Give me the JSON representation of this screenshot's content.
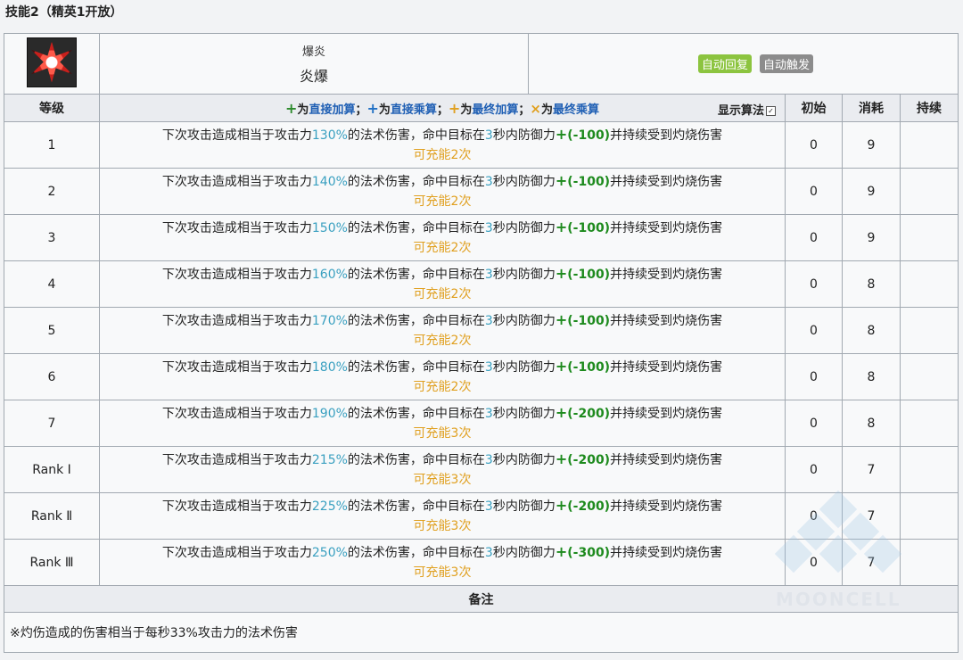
{
  "section_title": "技能2（精英1开放）",
  "skill": {
    "icon": "burst-icon",
    "name_sub": "爆炎",
    "name_main": "炎爆",
    "tags": [
      {
        "label": "自动回复",
        "color": "#8cc43f"
      },
      {
        "label": "自动触发",
        "color": "#8c8c8c"
      }
    ]
  },
  "columns": {
    "level": "等级",
    "legend": [
      {
        "sym": "+",
        "pre": "为",
        "key": "直接加算",
        "sep": "；"
      },
      {
        "sym": "+",
        "pre": "为",
        "key": "直接乘算",
        "sep": "；"
      },
      {
        "sym": "+",
        "pre": "为",
        "key": "最终加算",
        "sep": "；"
      },
      {
        "sym": "×",
        "pre": "为",
        "key": "最终乘算",
        "sep": ""
      }
    ],
    "show_algo": "显示算法",
    "show_algo_check": "✓",
    "initial": "初始",
    "cost": "消耗",
    "duration": "持续"
  },
  "desc_parts": {
    "a": "下次攻击造成相当于攻击力",
    "b": "的法术伤害，命中目标在",
    "c": "3",
    "d": "秒内防御力",
    "e": "并持续受到灼烧伤害"
  },
  "rows": [
    {
      "level": "1",
      "pct": "130%",
      "def": "(-100)",
      "charge": "可充能2次",
      "initial": "0",
      "cost": "9",
      "duration": ""
    },
    {
      "level": "2",
      "pct": "140%",
      "def": "(-100)",
      "charge": "可充能2次",
      "initial": "0",
      "cost": "9",
      "duration": ""
    },
    {
      "level": "3",
      "pct": "150%",
      "def": "(-100)",
      "charge": "可充能2次",
      "initial": "0",
      "cost": "9",
      "duration": ""
    },
    {
      "level": "4",
      "pct": "160%",
      "def": "(-100)",
      "charge": "可充能2次",
      "initial": "0",
      "cost": "8",
      "duration": ""
    },
    {
      "level": "5",
      "pct": "170%",
      "def": "(-100)",
      "charge": "可充能2次",
      "initial": "0",
      "cost": "8",
      "duration": ""
    },
    {
      "level": "6",
      "pct": "180%",
      "def": "(-100)",
      "charge": "可充能2次",
      "initial": "0",
      "cost": "8",
      "duration": ""
    },
    {
      "level": "7",
      "pct": "190%",
      "def": "(-200)",
      "charge": "可充能3次",
      "initial": "0",
      "cost": "8",
      "duration": ""
    },
    {
      "level": "Rank Ⅰ",
      "pct": "215%",
      "def": "(-200)",
      "charge": "可充能3次",
      "initial": "0",
      "cost": "7",
      "duration": ""
    },
    {
      "level": "Rank Ⅱ",
      "pct": "225%",
      "def": "(-200)",
      "charge": "可充能3次",
      "initial": "0",
      "cost": "7",
      "duration": ""
    },
    {
      "level": "Rank Ⅲ",
      "pct": "250%",
      "def": "(-300)",
      "charge": "可充能3次",
      "initial": "0",
      "cost": "7",
      "duration": ""
    }
  ],
  "note": {
    "header": "备注",
    "text": "※灼伤造成的伤害相当于每秒33%攻击力的法术伤害"
  },
  "watermark": "MOONCELL"
}
